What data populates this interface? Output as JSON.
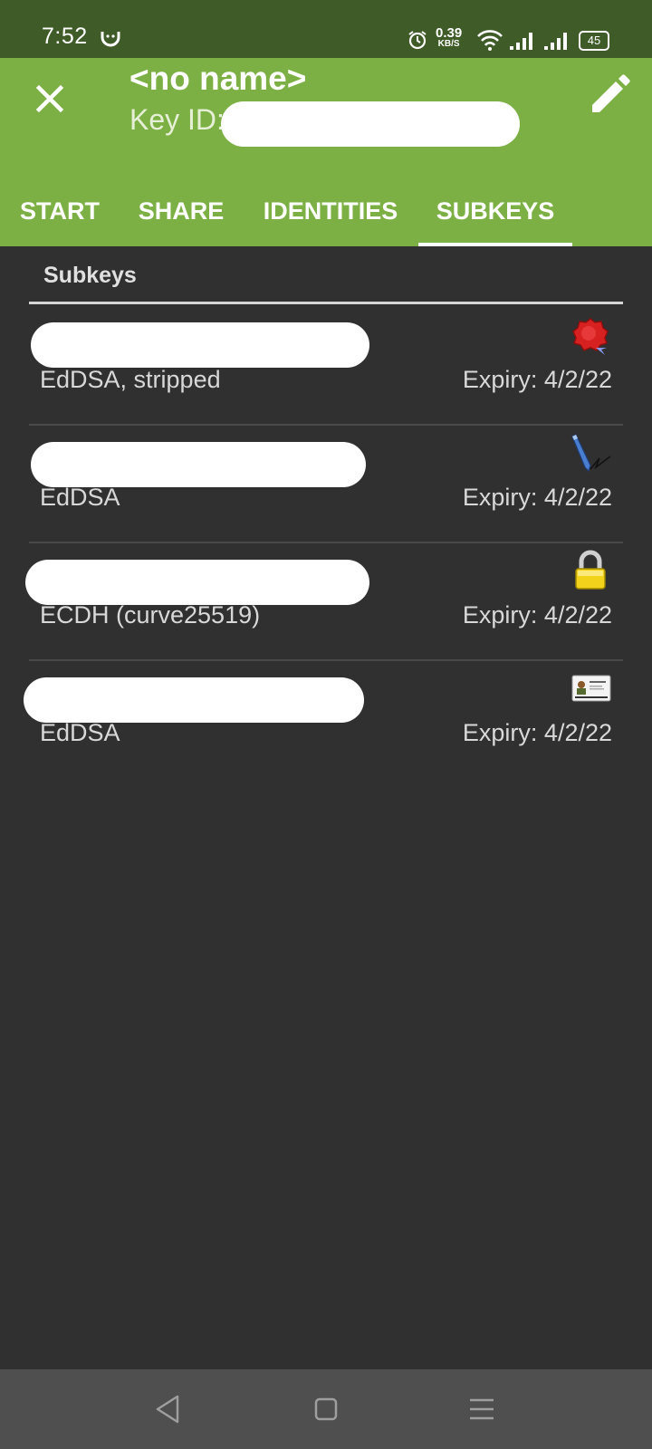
{
  "status_bar": {
    "time": "7:52",
    "net_speed": "0.39",
    "net_unit": "KB/S",
    "battery": "45"
  },
  "header": {
    "title": "<no name>",
    "key_id_label": "Key ID:"
  },
  "tabs": [
    {
      "label": "START",
      "selected": false
    },
    {
      "label": "SHARE",
      "selected": false
    },
    {
      "label": "IDENTITIES",
      "selected": false
    },
    {
      "label": "SUBKEYS",
      "selected": true
    }
  ],
  "section": {
    "title": "Subkeys"
  },
  "subkeys": [
    {
      "algorithm": "EdDSA, stripped",
      "expiry": "Expiry: 4/2/22",
      "icon": "certify-seal-icon"
    },
    {
      "algorithm": "EdDSA",
      "expiry": "Expiry: 4/2/22",
      "icon": "sign-pen-icon"
    },
    {
      "algorithm": "ECDH (curve25519)",
      "expiry": "Expiry: 4/2/22",
      "icon": "encrypt-lock-icon"
    },
    {
      "algorithm": "EdDSA",
      "expiry": "Expiry: 4/2/22",
      "icon": "authenticate-card-icon"
    }
  ],
  "colors": {
    "app_bar": "#7cb045",
    "status_bar": "#3f5b27",
    "background": "#303030",
    "nav_bar": "#4f4f4f"
  }
}
